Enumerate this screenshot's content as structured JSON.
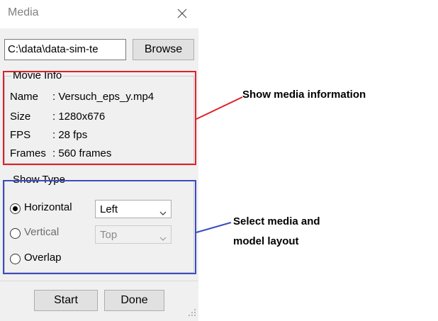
{
  "window": {
    "title": "Media",
    "path_value": "C:\\data\\data-sim-te",
    "browse_label": "Browse"
  },
  "movie_info": {
    "group_label": "Movie Info",
    "rows": [
      {
        "key": "Name",
        "value": ": Versuch_eps_y.mp4"
      },
      {
        "key": "Size",
        "value": ": 1280x676"
      },
      {
        "key": "FPS",
        "value": ": 28 fps"
      },
      {
        "key": "Frames",
        "value": ": 560 frames"
      }
    ]
  },
  "show_type": {
    "group_label": "Show Type",
    "options": [
      {
        "label": "Horizontal",
        "selected": true
      },
      {
        "label": "Vertical",
        "selected": false
      },
      {
        "label": "Overlap",
        "selected": false
      }
    ],
    "horizontal_select": "Left",
    "vertical_select": "Top"
  },
  "footer": {
    "start_label": "Start",
    "done_label": "Done"
  },
  "annotations": {
    "media_info": "Show media information",
    "layout_line1": "Select media and",
    "layout_line2": "model layout"
  },
  "colors": {
    "info_highlight": "#e0202a",
    "layout_highlight": "#3b4cc0"
  },
  "icons": {
    "close": "close-icon",
    "dropdown": "chevron-down-icon",
    "resize": "resize-grip-icon"
  }
}
